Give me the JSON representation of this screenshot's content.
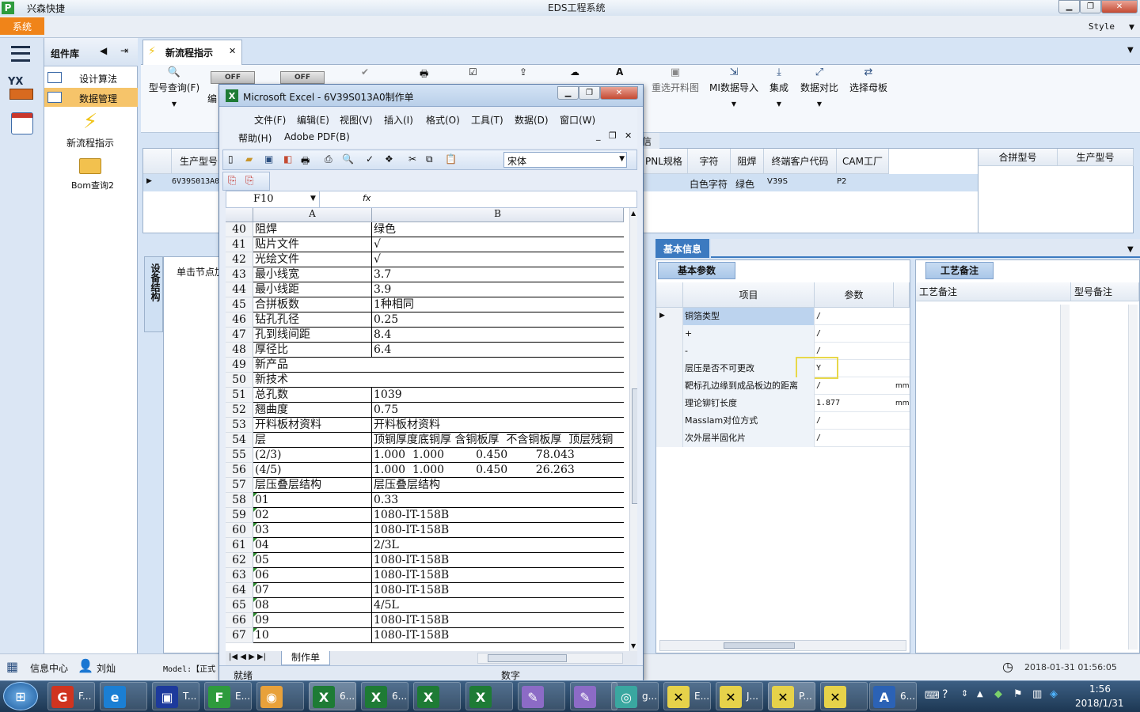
{
  "window": {
    "app_name": "兴森快捷",
    "title": "EDS工程系统"
  },
  "menubar": {
    "system": "系统",
    "style": "Style"
  },
  "leftnav": {
    "yx": "YX"
  },
  "complib": {
    "title": "组件库",
    "items": [
      {
        "label": "设计算法",
        "selected": false
      },
      {
        "label": "数据管理",
        "selected": true
      }
    ],
    "shortcuts": [
      "新流程指示",
      "Bom查询2"
    ]
  },
  "tabs": [
    {
      "label": "新流程指示"
    }
  ],
  "ribbon": {
    "toggles": [
      "OFF",
      "OFF"
    ],
    "left_buttons": [
      {
        "label": "型号查询(F)"
      },
      {
        "label": "编"
      }
    ],
    "right_buttons": [
      {
        "label": "重选开料图"
      },
      {
        "label": "MI数据导入"
      },
      {
        "label": "集成"
      },
      {
        "label": "数据对比"
      },
      {
        "label": "选择母板"
      }
    ]
  },
  "grid1": {
    "left_header": "生产型号",
    "left_value": "6V39S013A0",
    "headers": [
      "PNL规格",
      "字符",
      "阻焊",
      "终端客户代码",
      "CAM工厂",
      "合拼型号",
      "生产型号"
    ],
    "peek_header": "信息",
    "row": {
      "char": "白色字符",
      "solder": "绿色",
      "customer": "V39S",
      "cam": "P2"
    }
  },
  "tree_panel": {
    "vertical_tab": "设备结构",
    "hint": "单击节点加"
  },
  "basic_info": {
    "tab": "基本信息",
    "subtab": "基本参数",
    "col_item": "项目",
    "col_param": "参数",
    "rows": [
      {
        "item": "铜箔类型",
        "value": "/",
        "unit": ""
      },
      {
        "item": "+",
        "value": "/",
        "unit": ""
      },
      {
        "item": "-",
        "value": "/",
        "unit": ""
      },
      {
        "item": "层压是否不可更改",
        "value": "Y",
        "unit": ""
      },
      {
        "item": "靶标孔边缘到成品板边的距离",
        "value": "/",
        "unit": "mm"
      },
      {
        "item": "理论铆钉长度",
        "value": "1.877",
        "unit": "mm"
      },
      {
        "item": "Masslam对位方式",
        "value": "/",
        "unit": ""
      },
      {
        "item": "次外层半固化片",
        "value": "/",
        "unit": ""
      }
    ]
  },
  "craft": {
    "tab": "工艺备注",
    "col1": "工艺备注",
    "col2": "型号备注"
  },
  "statusbar": {
    "info": "信息中心",
    "user": "刘灿",
    "model": "Model:【正式",
    "datetime": "2018-01-31  01:56:05"
  },
  "excel": {
    "title": "Microsoft Excel - 6V39S013A0制作单",
    "menus": [
      "文件(F)",
      "编辑(E)",
      "视图(V)",
      "插入(I)",
      "格式(O)",
      "工具(T)",
      "数据(D)",
      "窗口(W)"
    ],
    "menus2": [
      "帮助(H)",
      "Adobe PDF(B)"
    ],
    "font": "宋体",
    "cell_ref": "F10",
    "fx": "fx",
    "col_a": "A",
    "col_b": "B",
    "rows": [
      {
        "n": "40",
        "a": "阻焊",
        "b": "绿色",
        "flag": false
      },
      {
        "n": "41",
        "a": "贴片文件",
        "b": "√",
        "flag": false
      },
      {
        "n": "42",
        "a": "光绘文件",
        "b": "√",
        "flag": false
      },
      {
        "n": "43",
        "a": "最小线宽",
        "b": "3.7",
        "flag": false
      },
      {
        "n": "44",
        "a": "最小线距",
        "b": "3.9",
        "flag": false
      },
      {
        "n": "45",
        "a": "合拼板数",
        "b": "1种相同",
        "flag": false
      },
      {
        "n": "46",
        "a": "钻孔孔径",
        "b": "0.25",
        "flag": false
      },
      {
        "n": "47",
        "a": "孔到线间距",
        "b": "8.4",
        "flag": false
      },
      {
        "n": "48",
        "a": "厚径比",
        "b": "6.4",
        "flag": false
      },
      {
        "n": "49",
        "a": "新产品",
        "b": "",
        "flag": false
      },
      {
        "n": "50",
        "a": "新技术",
        "b": "",
        "flag": false
      },
      {
        "n": "51",
        "a": "总孔数",
        "b": "1039",
        "flag": false
      },
      {
        "n": "52",
        "a": "翘曲度",
        "b": "0.75",
        "flag": false
      },
      {
        "n": "53",
        "a": "开料板材资料",
        "b": "开料板材资料",
        "flag": false
      },
      {
        "n": "54",
        "a": "层",
        "b": "顶铜厚度底铜厚 含铜板厚  不含铜板厚  顶层残铜",
        "flag": false
      },
      {
        "n": "55",
        "a": "(2/3)",
        "b": "1.000  1.000         0.450        78.043",
        "flag": false
      },
      {
        "n": "56",
        "a": "(4/5)",
        "b": "1.000  1.000         0.450        26.263",
        "flag": false
      },
      {
        "n": "57",
        "a": "层压叠层结构",
        "b": "层压叠层结构",
        "flag": false
      },
      {
        "n": "58",
        "a": "01",
        "b": "0.33",
        "flag": true
      },
      {
        "n": "59",
        "a": "02",
        "b": "1080-IT-158B",
        "flag": true
      },
      {
        "n": "60",
        "a": "03",
        "b": "1080-IT-158B",
        "flag": true
      },
      {
        "n": "61",
        "a": "04",
        "b": "2/3L",
        "flag": true
      },
      {
        "n": "62",
        "a": "05",
        "b": "1080-IT-158B",
        "flag": true
      },
      {
        "n": "63",
        "a": "06",
        "b": "1080-IT-158B",
        "flag": true
      },
      {
        "n": "64",
        "a": "07",
        "b": "1080-IT-158B",
        "flag": true
      },
      {
        "n": "65",
        "a": "08",
        "b": "4/5L",
        "flag": true
      },
      {
        "n": "66",
        "a": "09",
        "b": "1080-IT-158B",
        "flag": true
      },
      {
        "n": "67",
        "a": "10",
        "b": "1080-IT-158B",
        "flag": true
      }
    ],
    "sheet_tab": "制作单",
    "status_ready": "就绪",
    "status_mode": "数字"
  },
  "taskbar": {
    "items": [
      "F...",
      "T...",
      "E...",
      "6...",
      "6...",
      "g...",
      "E...",
      "J...",
      "P...",
      "6..."
    ],
    "time": "1:56",
    "date": "2018/1/31"
  },
  "colors": {
    "accent": "#3c7ac0",
    "system_menu": "#f08419",
    "nav_selected": "#f6c46a",
    "highlight_box": "#e8d84a"
  }
}
